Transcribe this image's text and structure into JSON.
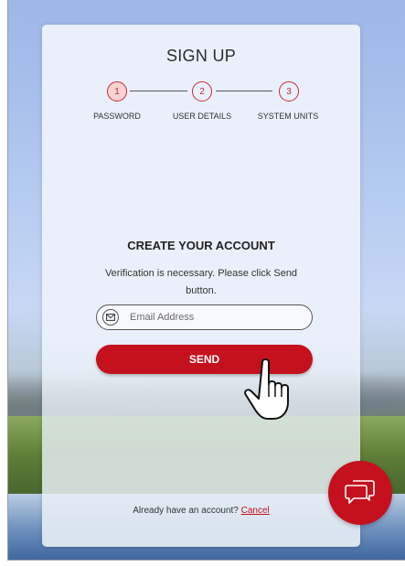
{
  "signup": {
    "title": "SIGN UP",
    "steps": [
      {
        "number": "1",
        "label": "PASSWORD",
        "active": true
      },
      {
        "number": "2",
        "label": "USER DETAILS",
        "active": false
      },
      {
        "number": "3",
        "label": "SYSTEM UNITS",
        "active": false
      }
    ],
    "heading": "CREATE YOUR ACCOUNT",
    "description": "Verification is necessary. Please click Send button.",
    "email": {
      "value": "",
      "placeholder": "Email Address",
      "icon": "mail-icon"
    },
    "send_label": "SEND",
    "footer": {
      "text": "Already have an account?",
      "link": "Cancel"
    }
  },
  "chat": {
    "icon": "chat-bubbles-icon"
  },
  "cursor": {
    "icon": "pointer-hand-icon"
  },
  "colors": {
    "accent": "#c5101e",
    "step": "#c9283a",
    "step_active_fill": "#f7d3d3"
  }
}
